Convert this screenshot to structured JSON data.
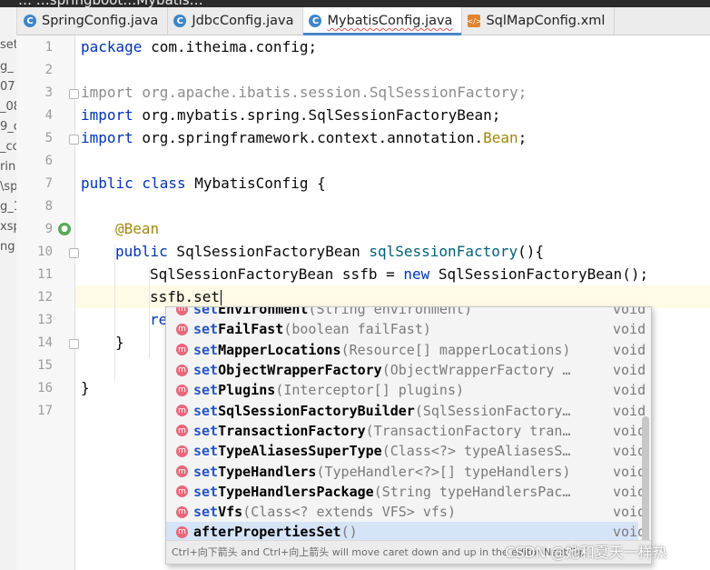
{
  "window_title_partial": "… …springboot…Mybatis…",
  "tabs": [
    {
      "label": "SpringConfig.java",
      "icon": "class-icon",
      "active": false
    },
    {
      "label": "JdbcConfig.java",
      "icon": "class-icon",
      "active": false
    },
    {
      "label": "MybatisConfig.java",
      "icon": "class-icon",
      "active": true
    },
    {
      "label": "SqlMapConfig.xml",
      "icon": "xml-file-icon",
      "active": false
    }
  ],
  "project_tree_fragments": [
    "set",
    "g_",
    "07",
    "_08",
    "9_c",
    "_co",
    "rin",
    "\\sp",
    "g_1",
    "xsp",
    "ng"
  ],
  "line_numbers": [
    "1",
    "2",
    "3",
    "4",
    "5",
    "6",
    "7",
    "8",
    "9",
    "10",
    "11",
    "12",
    "13",
    "14",
    "15",
    "16",
    "17"
  ],
  "code": {
    "l1": {
      "kw": "package",
      "rest": " com.itheima.config;"
    },
    "l3": {
      "text": "import org.apache.ibatis.session.SqlSessionFactory;"
    },
    "l4": {
      "kw": "import",
      "rest": " org.mybatis.spring.SqlSessionFactoryBean;"
    },
    "l5": {
      "kw": "import",
      "rest": " org.springframework.context.annotation.",
      "ann": "Bean",
      "end": ";"
    },
    "l7": {
      "kw": "public class",
      "rest": " MybatisConfig {"
    },
    "l9": {
      "ann": "@Bean"
    },
    "l10": {
      "kw": "public",
      "type": " SqlSessionFactoryBean ",
      "method": "sqlSessionFactory",
      "end": "(){"
    },
    "l11": {
      "pre": "SqlSessionFactoryBean ssfb = ",
      "kw": "new",
      "rest": " SqlSessionFactoryBean();"
    },
    "l12": {
      "text": "ssfb.set"
    },
    "l13": {
      "text": "re"
    },
    "l14": {
      "text": "}"
    },
    "l16": {
      "text": "}"
    }
  },
  "completion": {
    "items": [
      {
        "prefix": "set",
        "rest": "Environment",
        "params": "(String environment)",
        "ret": "void"
      },
      {
        "prefix": "set",
        "rest": "FailFast",
        "params": "(boolean failFast)",
        "ret": "void"
      },
      {
        "prefix": "set",
        "rest": "MapperLocations",
        "params": "(Resource[] mapperLocations)",
        "ret": "void"
      },
      {
        "prefix": "set",
        "rest": "ObjectWrapperFactory",
        "params": "(ObjectWrapperFactory …",
        "ret": "void"
      },
      {
        "prefix": "set",
        "rest": "Plugins",
        "params": "(Interceptor[] plugins)",
        "ret": "void"
      },
      {
        "prefix": "set",
        "rest": "SqlSessionFactoryBuilder",
        "params": "(SqlSessionFactory…",
        "ret": "void"
      },
      {
        "prefix": "set",
        "rest": "TransactionFactory",
        "params": "(TransactionFactory tran…",
        "ret": "void"
      },
      {
        "prefix": "set",
        "rest": "TypeAliasesSuperType",
        "params": "(Class<?> typeAliasesS…",
        "ret": "void"
      },
      {
        "prefix": "set",
        "rest": "TypeHandlers",
        "params": "(TypeHandler<?>[] typeHandlers)",
        "ret": "void"
      },
      {
        "prefix": "set",
        "rest": "TypeHandlersPackage",
        "params": "(String typeHandlersPac…",
        "ret": "void"
      },
      {
        "prefix": "set",
        "rest": "Vfs",
        "params": "(Class<? extends VFS> vfs)",
        "ret": "void"
      },
      {
        "prefix": "",
        "rest": "afterPropertiesSet",
        "params": "()",
        "ret": "void",
        "selected": true
      }
    ],
    "hint": "Ctrl+向下箭头 and Ctrl+向上箭头 will move caret down and up in the editor  Next Tip"
  },
  "watermark": "CSDN @她和夏天一样热",
  "colors": {
    "keyword": "#0033b3",
    "annotation": "#9e880d",
    "method_decl": "#00627a",
    "import_unused": "#8c8c8c",
    "selection": "#d5e4f7",
    "method_icon": "#e8677a"
  }
}
